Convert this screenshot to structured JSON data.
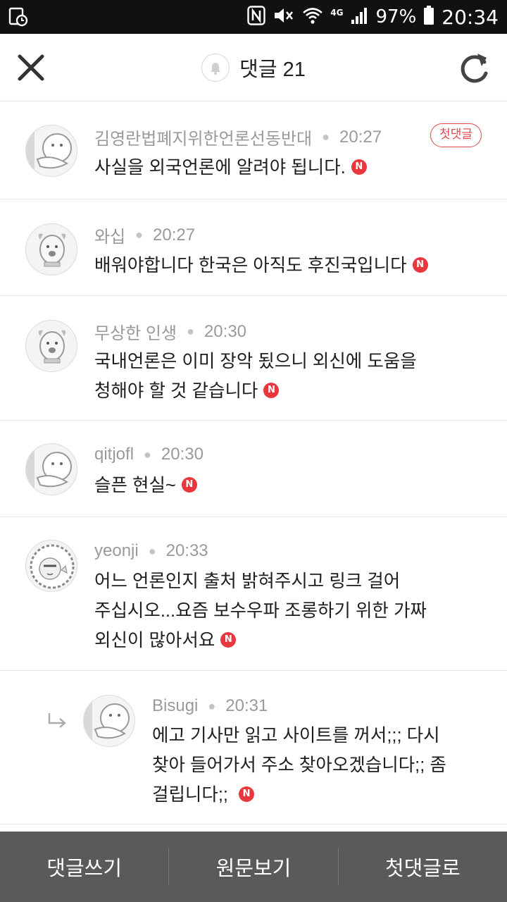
{
  "status_bar": {
    "network": "4G",
    "battery": "97%",
    "time": "20:34"
  },
  "header": {
    "title": "댓글 21",
    "icons": [
      "close-icon",
      "bell-icon",
      "refresh-icon"
    ]
  },
  "comments": [
    {
      "author": "김영란법폐지위한언론선동반대",
      "time": "20:27",
      "badge": "첫댓글",
      "lines": [
        "사실을 외국언론에 알려야 됩니다."
      ],
      "avatar": "ryan-avatar"
    },
    {
      "author": "와십",
      "time": "20:27",
      "lines": [
        "배워야합니다 한국은 아직도 후진국입니다"
      ],
      "avatar": "dog-avatar"
    },
    {
      "author": "무상한 인생",
      "time": "20:30",
      "lines": [
        "국내언론은 이미 장악 됬으니 외신에 도움을",
        "청해야 할 것 같습니다"
      ],
      "avatar": "dog-avatar"
    },
    {
      "author": "qitjofl",
      "time": "20:30",
      "lines": [
        "슬픈 현실~"
      ],
      "avatar": "ryan-avatar"
    },
    {
      "author": "yeonji",
      "time": "20:33",
      "lines": [
        "어느 언론인지 출처 밝혀주시고 링크 걸어",
        "주십시오...요즘 보수우파 조롱하기 위한 가짜",
        "외신이 많아서요"
      ],
      "avatar": "curly-avatar"
    },
    {
      "author": "Bisugi",
      "time": "20:31",
      "reply": true,
      "lines": [
        "에고 기사만 읽고 사이트를 꺼서;;; 다시",
        "찾아 들어가서 주소 찾아오겠습니다;; 좀",
        "걸립니다;;"
      ],
      "avatar": "ryan-avatar"
    }
  ],
  "n_badge": "N",
  "bottom_bar": {
    "write": "댓글쓰기",
    "original": "원문보기",
    "first": "첫댓글로"
  },
  "colors": {
    "accent_red": "#e8383d",
    "bottom_bar": "#5a5a5a",
    "meta_gray": "#9a9a9a"
  }
}
